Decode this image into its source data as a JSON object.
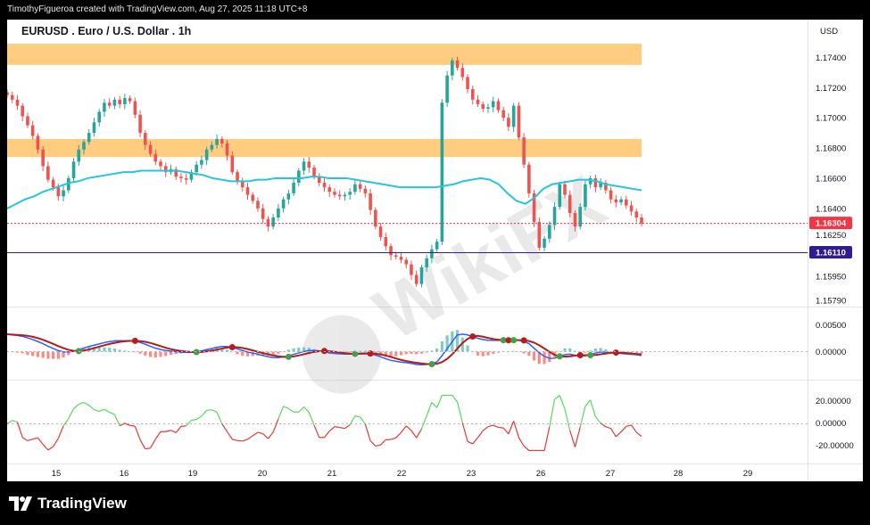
{
  "header": {
    "attribution": "TimothyFigueroa created with TradingView.com, Aug 27, 2025 11:18 UTC+8"
  },
  "chart": {
    "title": "EURUSD . Euro / U.S. Dollar . 1h",
    "currency": "USD",
    "watermark": "WikiFX"
  },
  "footer": {
    "brand": "TradingView"
  },
  "colors": {
    "zone": "#ffcc80",
    "up": "#26a69a",
    "down": "#ef5350",
    "ma": "#26c6da",
    "last_price": "#f23645",
    "level": "#311b92",
    "macd": "#2962ff",
    "signal": "#b71c1c",
    "osc_up": "#5cd65c",
    "osc_down": "#e53935"
  },
  "chart_data": {
    "type": "candlestick",
    "x_tick_labels": [
      "15",
      "16",
      "19",
      "20",
      "21",
      "22",
      "23",
      "26",
      "27",
      "28",
      "29"
    ],
    "price_axis": {
      "ticks": [
        "1.17400",
        "1.17200",
        "1.17000",
        "1.16800",
        "1.16600",
        "1.16400",
        "1.15950",
        "1.15790"
      ],
      "ylim": [
        1.1575,
        1.1765
      ],
      "last_price_label": "1.16304",
      "hidden_tick_label": "1.16250",
      "last_price": 1.16304,
      "level_label": "1.16110",
      "level": 1.1611
    },
    "resistance_zones": [
      {
        "from": 1.1735,
        "to": 1.1749
      },
      {
        "from": 1.1674,
        "to": 1.1686
      }
    ],
    "candles_close": [
      1.1715,
      1.1712,
      1.1708,
      1.1701,
      1.1695,
      1.1688,
      1.1679,
      1.1668,
      1.1659,
      1.1654,
      1.1648,
      1.1652,
      1.166,
      1.1671,
      1.1679,
      1.1684,
      1.169,
      1.1697,
      1.1704,
      1.171,
      1.1708,
      1.1712,
      1.1709,
      1.1713,
      1.1711,
      1.1702,
      1.169,
      1.1682,
      1.1676,
      1.1671,
      1.1668,
      1.1664,
      1.1666,
      1.1661,
      1.166,
      1.1659,
      1.1664,
      1.1669,
      1.1672,
      1.1679,
      1.1682,
      1.1686,
      1.1683,
      1.1675,
      1.1664,
      1.1658,
      1.1654,
      1.1649,
      1.1645,
      1.164,
      1.1633,
      1.1628,
      1.1634,
      1.164,
      1.1646,
      1.165,
      1.1657,
      1.1665,
      1.1671,
      1.1667,
      1.1661,
      1.1657,
      1.1654,
      1.1651,
      1.1649,
      1.1648,
      1.1649,
      1.1651,
      1.1656,
      1.1653,
      1.165,
      1.1639,
      1.1628,
      1.1621,
      1.1615,
      1.1609,
      1.1608,
      1.1606,
      1.1603,
      1.1596,
      1.159,
      1.1601,
      1.1607,
      1.1613,
      1.1618,
      1.171,
      1.1728,
      1.1738,
      1.1733,
      1.1727,
      1.1719,
      1.1712,
      1.1709,
      1.1706,
      1.1707,
      1.1711,
      1.1705,
      1.17,
      1.1694,
      1.1708,
      1.1687,
      1.1669,
      1.165,
      1.1631,
      1.1614,
      1.162,
      1.1629,
      1.1641,
      1.1656,
      1.1649,
      1.1637,
      1.1628,
      1.1641,
      1.1656,
      1.166,
      1.1654,
      1.1657,
      1.1652,
      1.1646,
      1.1644,
      1.1646,
      1.1642,
      1.1638,
      1.1634,
      1.163
    ],
    "moving_average": [
      1.164,
      1.1643,
      1.1646,
      1.1648,
      1.1651,
      1.1653,
      1.1655,
      1.1657,
      1.1658,
      1.166,
      1.1661,
      1.1662,
      1.1663,
      1.1664,
      1.1664,
      1.1665,
      1.1665,
      1.1665,
      1.1665,
      1.1665,
      1.1664,
      1.1663,
      1.1662,
      1.166,
      1.1659,
      1.1658,
      1.1658,
      1.1658,
      1.1659,
      1.1659,
      1.166,
      1.166,
      1.166,
      1.166,
      1.1661,
      1.1661,
      1.166,
      1.166,
      1.166,
      1.1659,
      1.1658,
      1.1657,
      1.1656,
      1.1655,
      1.1654,
      1.1654,
      1.1654,
      1.1654,
      1.1654,
      1.1655,
      1.1656,
      1.1658,
      1.1659,
      1.166,
      1.1659,
      1.1656,
      1.165,
      1.1645,
      1.1643,
      1.1647,
      1.1653,
      1.1656,
      1.1657,
      1.1658,
      1.1659,
      1.1659,
      1.1658,
      1.1656,
      1.1655,
      1.1654,
      1.1653,
      1.1652
    ],
    "macd_axis": {
      "ticks": [
        "0.00500",
        "0.00000"
      ]
    },
    "oscillator_axis": {
      "ticks": [
        "20.00000",
        "0.00000",
        "-20.00000"
      ]
    }
  }
}
